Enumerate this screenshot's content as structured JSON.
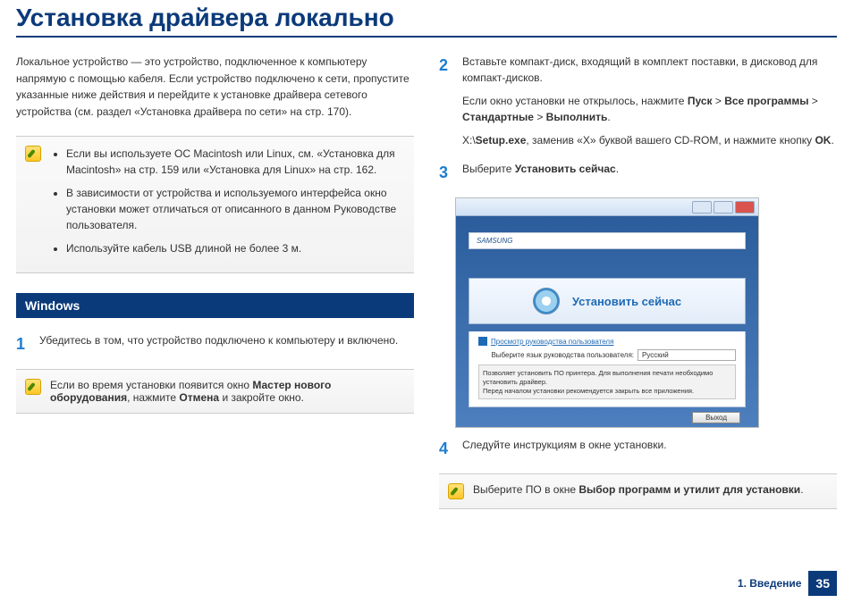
{
  "title": "Установка драйвера локально",
  "intro": "Локальное устройство — это устройство, подключенное к компьютеру напрямую с помощью кабеля. Если устройство подключено к сети, пропустите указанные ниже действия и перейдите к установке драйвера сетевого устройства (см. раздел «Установка драйвера по сети» на стр. 170).",
  "notes_top": [
    "Если вы используете ОС Macintosh или Linux, см. «Установка для Macintosh» на стр. 159 или «Установка для Linux» на стр. 162.",
    "В зависимости от устройства и используемого интерфейса окно установки может отличаться от описанного в данном Руководстве пользователя.",
    "Используйте кабель USB длиной не более 3 м."
  ],
  "section_windows": "Windows",
  "steps": {
    "s1": "Убедитесь в том, что устройство подключено к компьютеру и включено.",
    "note_after_1_a": "Если во время установки появится окно ",
    "note_after_1_b": "Мастер нового оборудования",
    "note_after_1_c": ", нажмите ",
    "note_after_1_d": "Отмена",
    "note_after_1_e": " и закройте окно.",
    "s2": "Вставьте компакт-диск, входящий в комплект поставки, в дисковод для компакт-дисков.",
    "s2_extra_a": "Если окно установки не открылось, нажмите ",
    "s2_path": [
      "Пуск",
      "Все программы",
      "Стандартные",
      "Выполнить"
    ],
    "s2_extra_b": ".",
    "s2_cmd_a": "X:\\",
    "s2_cmd_b": "Setup.exe",
    "s2_cmd_c": ", заменив «X» буквой вашего CD-ROM, и нажмите кнопку ",
    "s2_cmd_d": "OK",
    "s2_cmd_e": ".",
    "s3_a": "Выберите ",
    "s3_b": "Установить сейчас",
    "s3_c": ".",
    "s4": "Следуйте инструкциям в окне установки.",
    "note_after_4_a": "Выберите ПО в окне ",
    "note_after_4_b": "Выбор программ и утилит для установки",
    "note_after_4_c": "."
  },
  "screenshot": {
    "logo": "SAMSUNG",
    "install_now": "Установить сейчас",
    "manual_link": "Просмотр руководства пользователя",
    "lang_label": "Выберите язык руководства пользователя:",
    "lang_value": "Русский",
    "hint1": "Позволяет установить ПО принтера. Для выполнения печати необходимо установить драйвер.",
    "hint2": "Перед началом установки рекомендуется закрыть все приложения.",
    "exit": "Выход"
  },
  "footer_chapter": "1. Введение",
  "page_number": "35"
}
